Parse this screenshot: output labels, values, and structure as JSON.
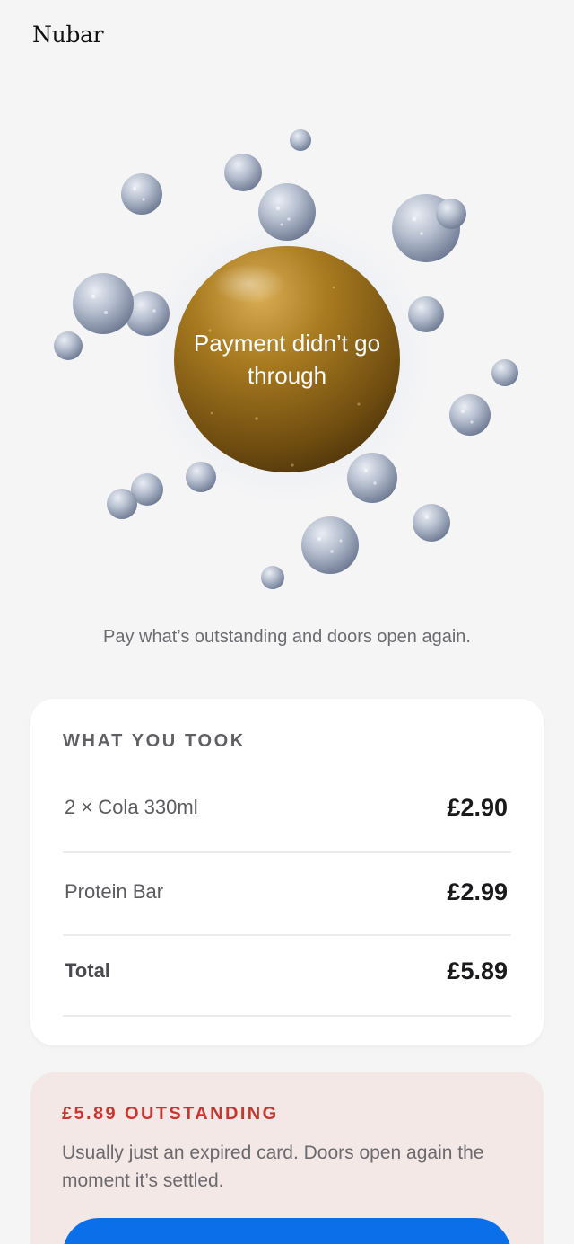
{
  "header": {
    "brand": "Nubar"
  },
  "hero": {
    "title": "Payment didn’t go through"
  },
  "subtitle": "Pay what’s outstanding and doors open again.",
  "order": {
    "heading": "WHAT YOU TOOK",
    "items": [
      {
        "name": "2 × Cola 330ml",
        "price": "£2.90"
      },
      {
        "name": "Protein Bar",
        "price": "£2.99"
      }
    ],
    "total": {
      "label": "Total",
      "price": "£5.89"
    }
  },
  "alert": {
    "title": "£5.89 OUTSTANDING",
    "text": "Usually just an expired card. Doors open again the moment it’s settled."
  },
  "colors": {
    "accent": "#0a6fe8",
    "alert": "#c8372d",
    "orb": "#a77a1c"
  }
}
